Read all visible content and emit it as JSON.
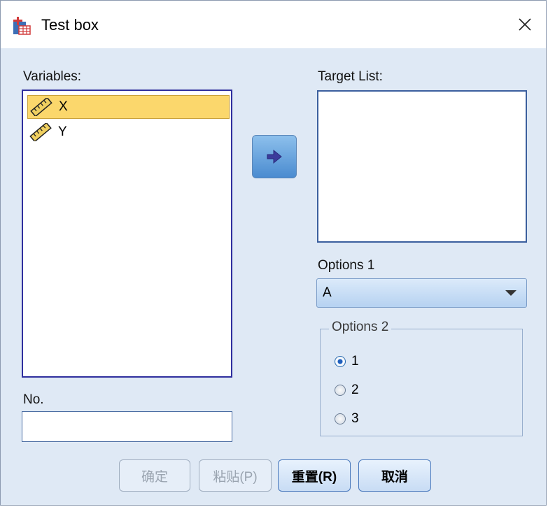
{
  "window": {
    "title": "Test box",
    "icon": "spss-dialog-icon",
    "close_icon": "close-icon"
  },
  "variables": {
    "label": "Variables:",
    "items": [
      {
        "name": "X",
        "icon": "ruler-icon",
        "selected": true
      },
      {
        "name": "Y",
        "icon": "ruler-icon",
        "selected": false
      }
    ]
  },
  "move_button": {
    "icon": "arrow-right-icon"
  },
  "target_list": {
    "label": "Target List:",
    "items": []
  },
  "options1": {
    "label": "Options 1",
    "selected": "A"
  },
  "options2": {
    "label": "Options 2",
    "choices": [
      {
        "label": "1",
        "checked": true
      },
      {
        "label": "2",
        "checked": false
      },
      {
        "label": "3",
        "checked": false
      }
    ]
  },
  "number_field": {
    "label": "No.",
    "value": ""
  },
  "buttons": {
    "ok": "确定",
    "paste": "粘贴(P)",
    "reset": "重置(R)",
    "cancel": "取消"
  }
}
